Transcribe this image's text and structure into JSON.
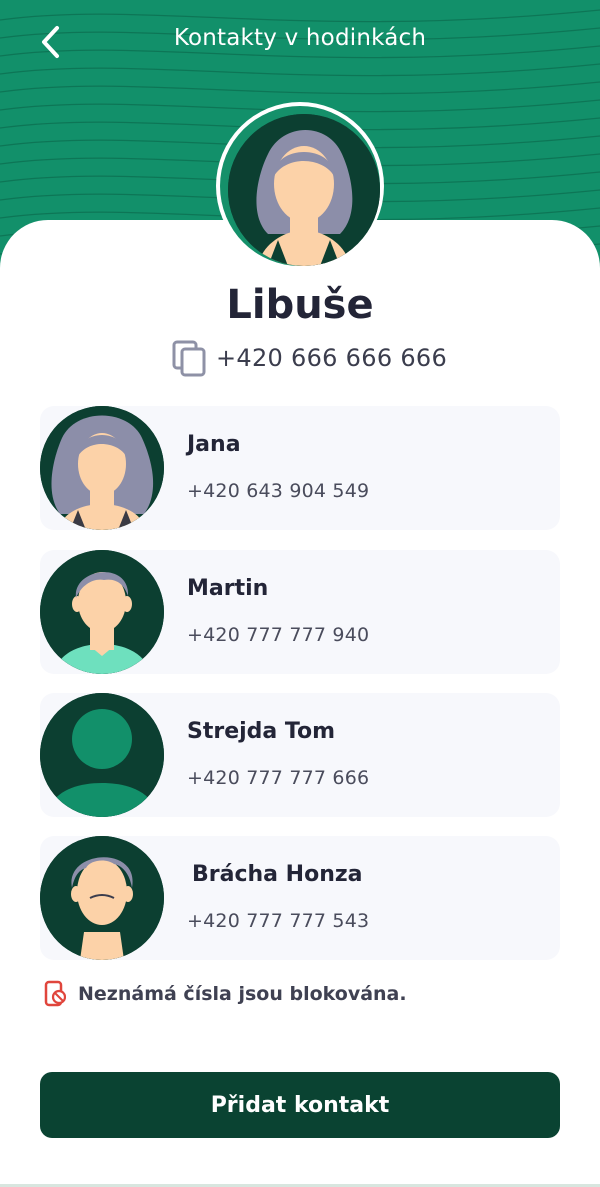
{
  "header": {
    "title": "Kontakty v hodinkách",
    "back_icon": "chevron-left-icon",
    "background_color": "#12906a"
  },
  "owner": {
    "name": "Libuše",
    "phone": "+420 666 666 666",
    "copy_icon": "copy-icon"
  },
  "contacts": [
    {
      "name": "Jana",
      "phone": "+420 643 904 549",
      "avatar": "woman-curly-hair-avatar"
    },
    {
      "name": "Martin",
      "phone": "+420 777 777 940",
      "avatar": "man-avatar"
    },
    {
      "name": "Strejda Tom",
      "phone": "+420 777 777 666",
      "avatar": "default-person-avatar"
    },
    {
      "name": "Brácha Honza",
      "phone": "+420 777 777 543",
      "avatar": "old-man-avatar"
    }
  ],
  "notice": {
    "text": "Neznámá čísla jsou blokována.",
    "icon": "blocked-phone-icon",
    "icon_color": "#e0453c"
  },
  "actions": {
    "add_contact_label": "Přidat kontakt",
    "button_color": "#0a4332"
  }
}
